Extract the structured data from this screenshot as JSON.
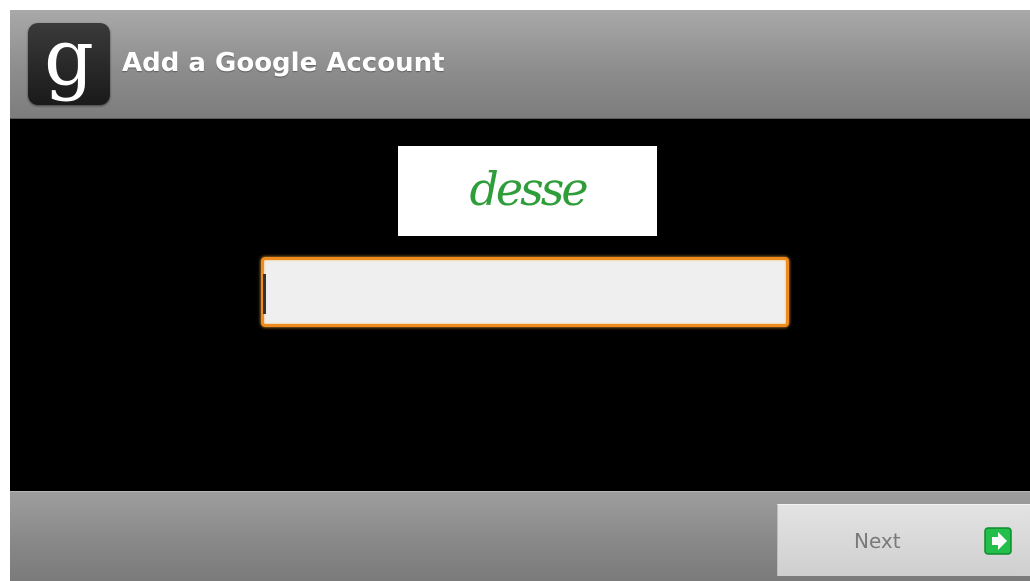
{
  "window": {
    "title": "Add a Google Account",
    "app_icon_glyph": "g",
    "app_icon_name": "google-g-icon"
  },
  "captcha": {
    "text": "desse"
  },
  "answer_field": {
    "value": "",
    "placeholder": ""
  },
  "footer": {
    "next_label": "Next",
    "next_icon_name": "arrow-right-icon"
  },
  "colors": {
    "accent_orange": "#f08c1e",
    "captcha_green": "#2f9e3a",
    "next_icon_green": "#22c04a"
  }
}
